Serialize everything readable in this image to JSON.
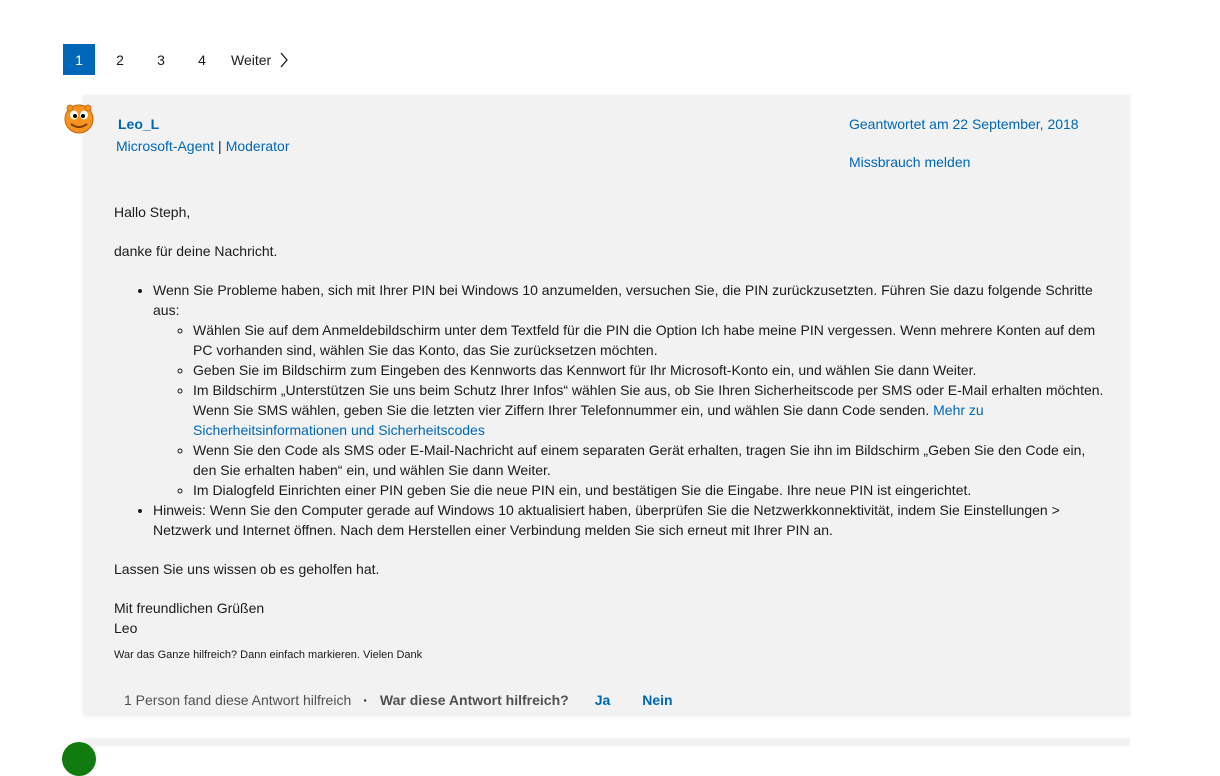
{
  "pagination": {
    "pages": [
      "1",
      "2",
      "3",
      "4"
    ],
    "active": "1",
    "next_label": "Weiter"
  },
  "answer": {
    "author": "Leo_L",
    "role_agent": "Microsoft-Agent",
    "role_moderator": "Moderator",
    "role_separator": "|",
    "answered": "Geantwortet am 22 September, 2018",
    "report": "Missbrauch melden",
    "greeting": "Hallo Steph,",
    "thanks": "danke für deine Nachricht.",
    "bullet1": "Wenn Sie Probleme haben, sich mit Ihrer PIN bei Windows 10 anzumelden, versuchen Sie, die PIN zurückzusetzten. Führen Sie dazu folgende Schritte aus:",
    "steps": [
      "Wählen Sie auf dem Anmeldebildschirm unter dem Textfeld für die PIN die Option Ich habe meine PIN vergessen. Wenn mehrere Konten auf dem PC vorhanden sind, wählen Sie das Konto, das Sie zurücksetzen möchten.",
      "Geben Sie im Bildschirm zum Eingeben des Kennworts das Kennwort für Ihr Microsoft-Konto ein, und wählen Sie dann Weiter.",
      "Im Bildschirm „Unterstützen Sie uns beim Schutz Ihrer Infos“ wählen Sie aus, ob Sie Ihren Sicherheitscode per SMS oder E-Mail erhalten möchten. Wenn Sie SMS wählen, geben Sie die letzten vier Ziffern Ihrer Telefonnummer ein, und wählen Sie dann Code senden.",
      "Wenn Sie den Code als SMS oder E-Mail-Nachricht auf einem separaten Gerät erhalten, tragen Sie ihn im Bildschirm „Geben Sie den Code ein, den Sie erhalten haben“ ein, und wählen Sie dann Weiter.",
      "Im Dialogfeld Einrichten einer PIN geben Sie die neue PIN ein, und bestätigen Sie die Eingabe. Ihre neue PIN ist eingerichtet."
    ],
    "step3_link": "Mehr zu Sicherheitsinformationen und Sicherheitscodes",
    "bullet2": " Hinweis: Wenn Sie den Computer gerade auf Windows 10 aktualisiert haben, überprüfen Sie die Netzwerkkonnektivität, indem Sie Einstellungen > Netzwerk und Internet öffnen. Nach dem Herstellen einer Verbindung melden Sie sich erneut mit Ihrer PIN an.",
    "closing": "Lassen Sie uns wissen ob es geholfen hat.",
    "regards": "Mit freundlichen Grüßen",
    "signature": "Leo",
    "helpful_note": "War das Ganze hilfreich? Dann einfach markieren. Vielen Dank"
  },
  "feedback": {
    "count": "1 Person fand diese Antwort hilfreich",
    "separator": "·",
    "question": "War diese Antwort hilfreich?",
    "yes": "Ja",
    "no": "Nein"
  },
  "colors": {
    "accent": "#0067b8",
    "card_bg": "#f2f2f2"
  }
}
